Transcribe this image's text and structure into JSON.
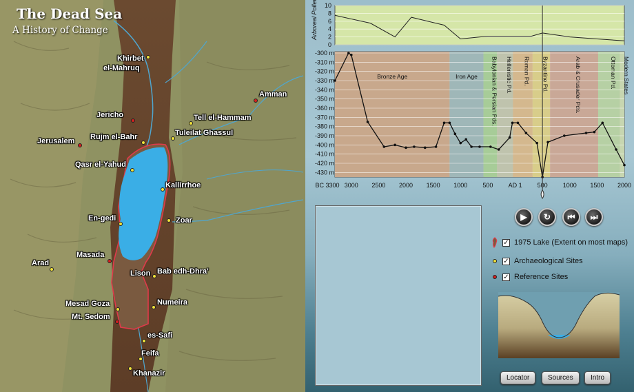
{
  "map": {
    "title": "The Dead Sea",
    "subtitle": "A History of Change",
    "sites": [
      {
        "label": "Khirbet",
        "label2": "el-Mahruq",
        "color": "yellow"
      },
      {
        "label": "Amman",
        "color": "red"
      },
      {
        "label": "Jericho",
        "color": "red"
      },
      {
        "label": "Tell el-Hammam",
        "color": "yellow"
      },
      {
        "label": "Rujm el-Bahr",
        "color": "yellow"
      },
      {
        "label": "Tuleilat Ghassul",
        "color": "yellow"
      },
      {
        "label": "Jerusalem",
        "color": "red"
      },
      {
        "label": "Qasr el-Yahud",
        "color": "yellow"
      },
      {
        "label": "Kallirrhoe",
        "color": "yellow"
      },
      {
        "label": "En-gedi",
        "color": "yellow"
      },
      {
        "label": "Zoar",
        "color": "yellow"
      },
      {
        "label": "Arad",
        "color": "yellow"
      },
      {
        "label": "Masada",
        "color": "red"
      },
      {
        "label": "Lison",
        "color": "yellow"
      },
      {
        "label": "Bab edh-Dhra'",
        "color": "yellow"
      },
      {
        "label": "Mesad Goza",
        "color": "yellow"
      },
      {
        "label": "Numeira",
        "color": "yellow"
      },
      {
        "label": "Mt. Sedom",
        "color": "red"
      },
      {
        "label": "es-Safi",
        "color": "yellow"
      },
      {
        "label": "Feifa",
        "color": "yellow"
      },
      {
        "label": "Khanazir",
        "color": "yellow"
      }
    ]
  },
  "chart_data": [
    {
      "type": "line",
      "ylabel": "Arboreal Pollen %",
      "ylim": [
        0,
        10
      ],
      "yticks": [
        0,
        2,
        4,
        6,
        8,
        10
      ],
      "x": [
        -3300,
        -2650,
        -2200,
        -1900,
        -1300,
        -1000,
        -500,
        300,
        500,
        1000,
        1500,
        2000
      ],
      "y": [
        7.5,
        5.5,
        2,
        7,
        5,
        1.5,
        2.2,
        2.2,
        3,
        2,
        1.5,
        1
      ],
      "marker": {
        "x": 500
      }
    },
    {
      "type": "line",
      "ylabel": "",
      "ylim": [
        -435,
        -300
      ],
      "yticks": [
        -300,
        -310,
        -320,
        -330,
        -340,
        -350,
        -360,
        -370,
        -380,
        -390,
        -400,
        -410,
        -420,
        -430
      ],
      "ytick_labels": [
        "-300 m",
        "-310 m",
        "-320 m",
        "-330 m",
        "-340 m",
        "-350 m",
        "-360 m",
        "-370 m",
        "-380 m",
        "-390 m",
        "-400 m",
        "-410 m",
        "-420 m",
        "-430 m"
      ],
      "xticks": [
        -3000,
        -2500,
        -2000,
        -1500,
        -1000,
        -500,
        1,
        500,
        1000,
        1500,
        2000
      ],
      "xtick_labels": [
        "BC 3300",
        "3000",
        "2500",
        "2000",
        "1500",
        "1000",
        "500",
        "AD 1",
        "500",
        "1000",
        "1500",
        "2000"
      ],
      "x": [
        -3300,
        -3050,
        -3000,
        -2700,
        -2400,
        -2200,
        -2000,
        -1850,
        -1650,
        -1450,
        -1300,
        -1200,
        -1100,
        -1000,
        -900,
        -800,
        -650,
        -450,
        -300,
        -100,
        -50,
        50,
        200,
        400,
        500,
        600,
        900,
        1300,
        1450,
        1600,
        1850,
        2000
      ],
      "y": [
        -330,
        -300,
        -302,
        -375,
        -402,
        -400,
        -403,
        -402,
        -403,
        -402,
        -376,
        -376,
        -388,
        -398,
        -394,
        -402,
        -402,
        -402,
        -405,
        -392,
        -376,
        -376,
        -387,
        -398,
        -435,
        -397,
        -390,
        -387,
        -386,
        -376,
        -405,
        -422
      ],
      "periods": [
        {
          "name": "Bronze Age",
          "from": -3300,
          "to": -1200,
          "color": "#c8a88c"
        },
        {
          "name": "Iron Age",
          "from": -1200,
          "to": -580,
          "color": "#9fb7b8"
        },
        {
          "name": "Babylonian & Persian Pds.",
          "from": -580,
          "to": -330,
          "color": "#a7cc98"
        },
        {
          "name": "Hellenistic Pd.",
          "from": -330,
          "to": -40,
          "color": "#bfc3ad"
        },
        {
          "name": "Roman Pd.",
          "from": -40,
          "to": 320,
          "color": "#d4b88e"
        },
        {
          "name": "Byzantine Pd.",
          "from": 320,
          "to": 640,
          "color": "#d8cd8a"
        },
        {
          "name": "Arab & Crusader Pds.",
          "from": 640,
          "to": 1520,
          "color": "#c9a897"
        },
        {
          "name": "Ottoman Pd.",
          "from": 1520,
          "to": 1920,
          "color": "#b6d0a4"
        },
        {
          "name": "Modern States",
          "from": 1920,
          "to": 2000,
          "color": "#c7d6b0"
        }
      ]
    }
  ],
  "controls": {
    "play_icon": "play-icon",
    "reset_icon": "reset-icon",
    "rewind_icon": "rewind-icon",
    "forward_icon": "fast-forward-icon"
  },
  "legend": [
    {
      "label": "1975 Lake (Extent on most maps)",
      "symbol": "lake-outline-icon",
      "checked": true
    },
    {
      "label": "Archaeological Sites",
      "symbol": "yellow-dot-icon",
      "checked": true
    },
    {
      "label": "Reference Sites",
      "symbol": "red-dot-icon",
      "checked": true
    }
  ],
  "buttons": {
    "locator": "Locator",
    "sources": "Sources",
    "intro": "Intro"
  },
  "colors": {
    "lake": "#3aaee6",
    "lake_outline": "#e03a4a",
    "archaeological": "#f2e33a",
    "reference": "#d4201f",
    "pollen_bg": "#d5e6a8"
  }
}
